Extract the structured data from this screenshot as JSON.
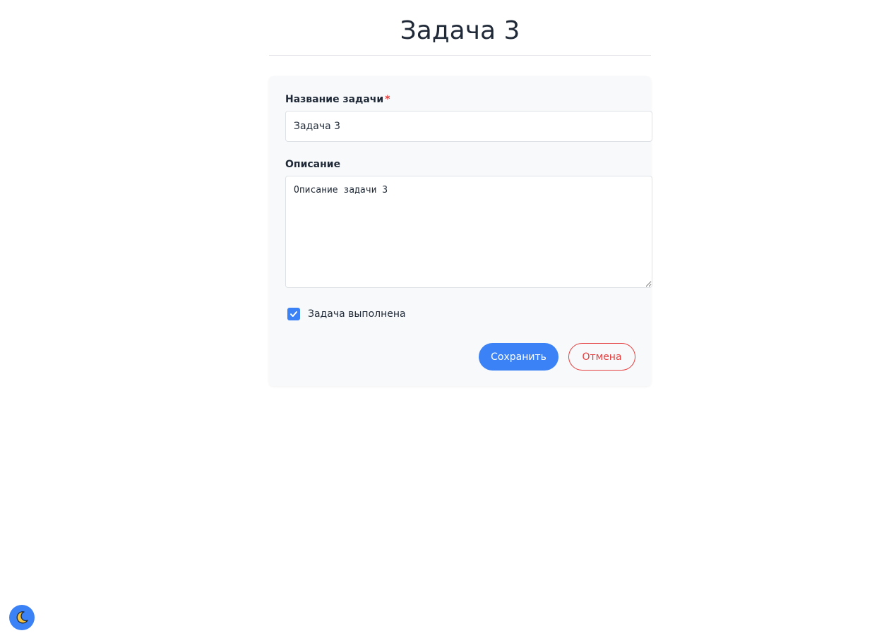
{
  "page": {
    "title": "Задача 3"
  },
  "form": {
    "title_label": "Название задачи",
    "required_mark": "*",
    "title_value": "Задача 3",
    "description_label": "Описание",
    "description_value": "Описание задачи 3",
    "completed_checked": true,
    "completed_label": "Задача выполнена",
    "save_label": "Сохранить",
    "cancel_label": "Отмена"
  },
  "theme_toggle": {
    "icon": "moon-icon"
  },
  "colors": {
    "accent": "#3b82f6",
    "danger": "#e53e3e",
    "card_background": "#f8f9fa"
  }
}
